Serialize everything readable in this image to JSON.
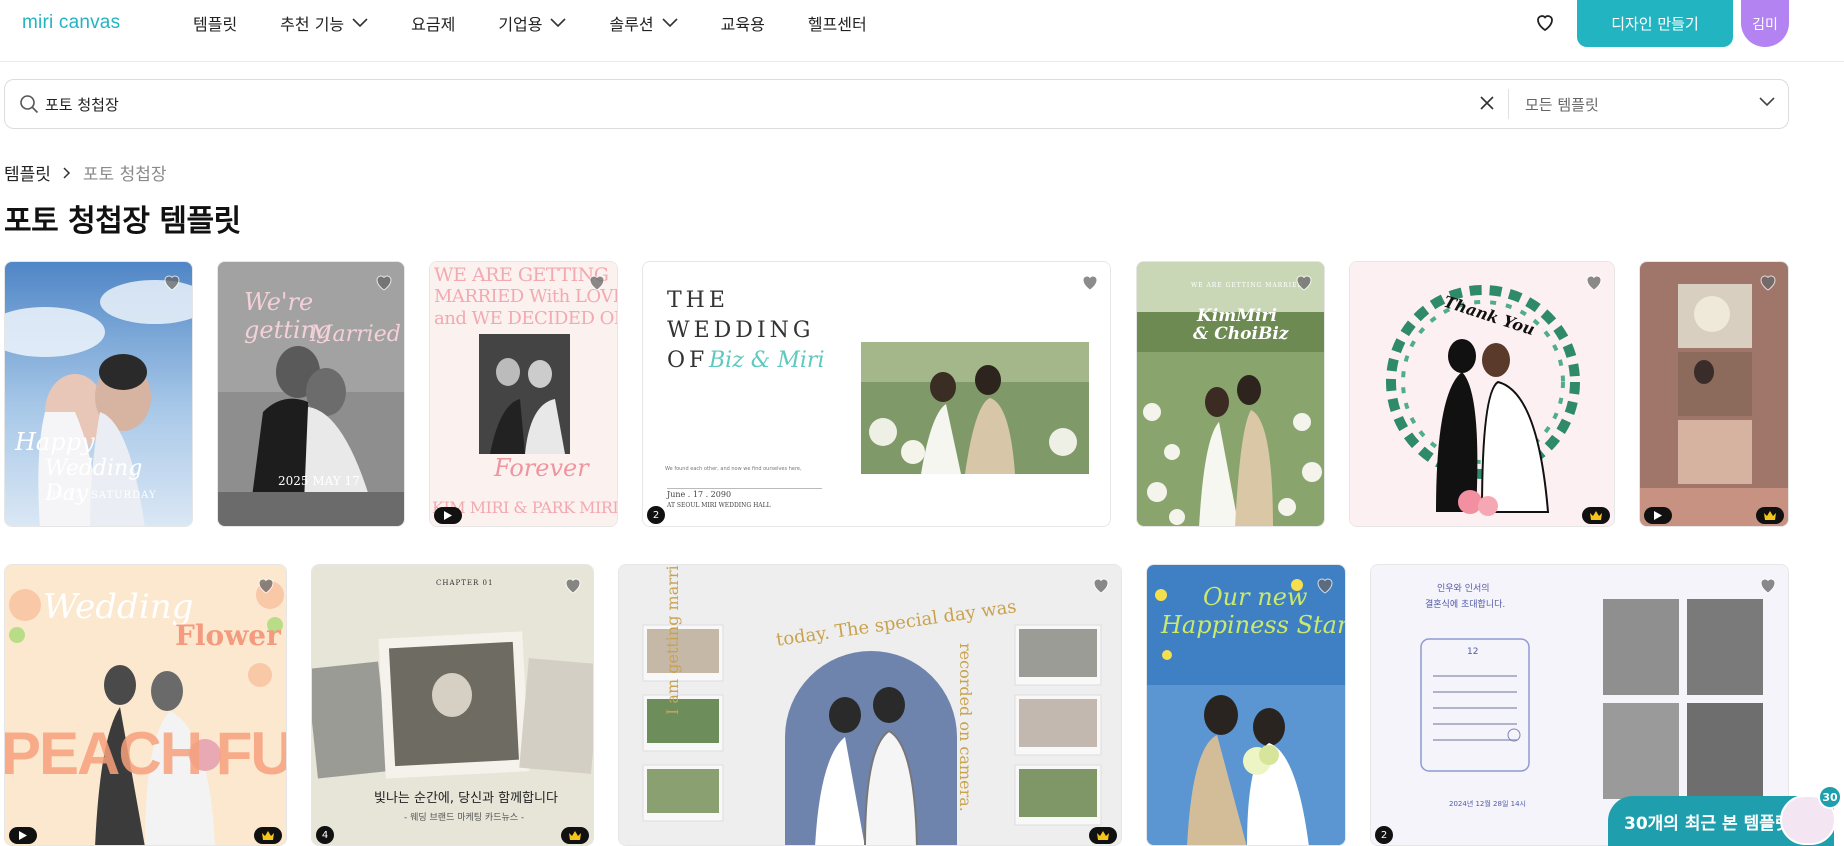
{
  "nav": {
    "logo": "miri canvas",
    "items": [
      {
        "label": "템플릿",
        "dropdown": false
      },
      {
        "label": "추천 기능",
        "dropdown": true
      },
      {
        "label": "요금제",
        "dropdown": false
      },
      {
        "label": "기업용",
        "dropdown": true
      },
      {
        "label": "솔루션",
        "dropdown": true
      },
      {
        "label": "교육용",
        "dropdown": false
      },
      {
        "label": "헬프센터",
        "dropdown": false
      }
    ],
    "create_button": "디자인 만들기",
    "avatar": "김미"
  },
  "search": {
    "value": "포토 청첩장",
    "filter": "모든 템플릿"
  },
  "breadcrumb": {
    "root": "템플릿",
    "current": "포토 청첩장"
  },
  "page_title": "포토 청첩장 템플릿",
  "cards": [
    {
      "text": [
        "Happy",
        "Wedding Day",
        "05.17. SATURDAY"
      ],
      "badge": "",
      "video": false,
      "premium": false
    },
    {
      "text": [
        "We're getting",
        "Married",
        "2025 MAY 17"
      ],
      "badge": "",
      "video": false,
      "premium": false
    },
    {
      "text": [
        "WE ARE GETTING",
        "MARRIED With LOVE",
        "and WE DECIDED ON",
        "Forever",
        "KIM MIRI & PARK MIRI"
      ],
      "badge": "",
      "video": true,
      "premium": false
    },
    {
      "text": [
        "THE",
        "WEDDING",
        "OF",
        "Biz & Miri",
        "June . 17 . 2090",
        "AT SEOUL MIRI WEDDING HALL"
      ],
      "badge": "2",
      "video": false,
      "premium": false
    },
    {
      "text": [
        "WE ARE GETTING MARRIED",
        "KimMiri",
        "& ChoiBiz"
      ],
      "badge": "",
      "video": false,
      "premium": false
    },
    {
      "text": [
        "Thank You"
      ],
      "badge": "",
      "video": false,
      "premium": true
    },
    {
      "text": [],
      "badge": "",
      "video": true,
      "premium": true
    },
    {
      "text": [
        "Wedding",
        "Flower",
        "PEACH FUZZ"
      ],
      "badge": "",
      "video": true,
      "premium": true
    },
    {
      "text": [
        "CHAPTER 01",
        "빛나는 순간에, 당신과 함께합니다",
        "- 웨딩 브랜드 마케팅 카드뉴스 -"
      ],
      "badge": "4",
      "video": false,
      "premium": true
    },
    {
      "text": [
        "today. The special day was",
        "I am getting married",
        "recorded on camera."
      ],
      "badge": "",
      "video": false,
      "premium": true
    },
    {
      "text": [
        "Our new",
        "Happiness Start"
      ],
      "badge": "",
      "video": false,
      "premium": false
    },
    {
      "text": [
        "인우와 인서의",
        "결혼식에 초대합니다.",
        "12",
        "2024년 12월 28일 14시"
      ],
      "badge": "2",
      "video": false,
      "premium": false
    }
  ],
  "recent": {
    "label": "30개의 최근 본 템플릿",
    "count": "30"
  },
  "colors": {
    "accent": "#22b5c1",
    "avatar": "#b483f2",
    "recent": "#1f9fae"
  }
}
